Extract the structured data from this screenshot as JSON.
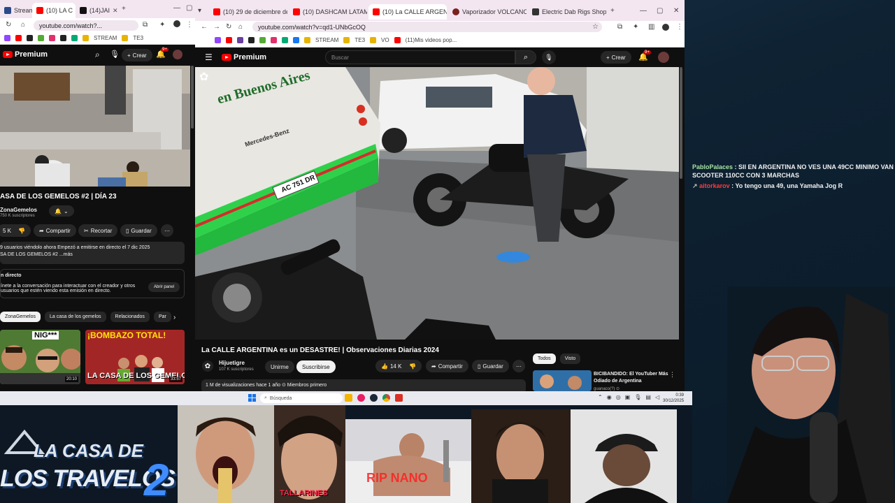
{
  "left_browser": {
    "tabs": [
      {
        "label": "Stream",
        "active": false,
        "color": "#2b4a8a"
      },
      {
        "label": "(10) LA C",
        "active": true,
        "color": "#ff0000"
      },
      {
        "label": "(14)JAI",
        "active": false,
        "color": "#111111"
      }
    ],
    "url": "youtube.com/watch?...",
    "bookmark_label": "STREAM",
    "bookmark_label2": "TE3",
    "yt_brand": "Premium",
    "create_label": "Crear",
    "notif_count": "9+",
    "video_title": "ASA DE LOS GEMELOS #2 | DÍA 23",
    "channel_name": "ZonaGemelos",
    "channel_subs": "750 K suscriptores",
    "likes": "5 K",
    "share_label": "Compartir",
    "clip_label": "Recortar",
    "save_label": "Guardar",
    "desc_line1": "9 usuarios viéndolo ahora  Empezó a emitirse en directo el 7 dic 2025",
    "desc_line2": "SA DE LOS GEMELOS #2 ...más",
    "live_heading": "n directo",
    "live_text1": "ínete a la conversación para interactuar con el creador y otros",
    "live_text2": "usuarios que estén viendo esta emisión en directo.",
    "open_panel": "Abrir panel",
    "chips": [
      "ZonaGemelos",
      "La casa de los gemelos",
      "Relacionados",
      "Par"
    ],
    "thumb1_caption": "NIG***",
    "thumb1_time": "20:10",
    "thumb2_caption": "¡BOMBAZO TOTAL!",
    "thumb2_sub": "LA CASA DE LOS GEMELO",
    "thumb2_time": "33:57"
  },
  "right_browser": {
    "tabs": [
      {
        "label": "(10) 29 de diciembre de 2025",
        "active": false,
        "color": "#ff0000"
      },
      {
        "label": "(10) DASHCAM LATAM #1",
        "active": false,
        "color": "#ff0000"
      },
      {
        "label": "(10) La CALLE ARGENTIN",
        "active": true,
        "color": "#ff0000"
      },
      {
        "label": "Vaporizador VOLCANO HYBR",
        "active": false,
        "color": "#7a2020"
      },
      {
        "label": "Electric Dab Rigs Shop | Puff",
        "active": false,
        "color": "#333333"
      }
    ],
    "url": "youtube.com/watch?v=qd1-UNbGcOQ",
    "bookmarks": [
      "STREAM",
      "TE3",
      "VO",
      "(11)Mis videos pop..."
    ],
    "yt_brand": "Premium",
    "search_placeholder": "Buscar",
    "create_label": "Crear",
    "notif_count": "9+",
    "video_title": "La CALLE ARGENTINA es un DESASTRE! | Observaciones Diarias 2024",
    "channel_name": "Hijuetigre",
    "channel_subs": "107 K suscriptores",
    "join_label": "Unirme",
    "subscribe_label": "Suscribirse",
    "likes": "14 K",
    "share_label": "Compartir",
    "save_label": "Guardar",
    "views_line": "1 M de visualizaciones  hace 1 año  ⊙ Miembros primero",
    "filter_chips": [
      "Todos",
      "Visto"
    ],
    "bus_text": "en Buenos Aires",
    "bus_brand": "Mercedes-Benz",
    "plate": "AC 751 DR",
    "rec_title": "BICIBANDIDO: El YouTuber Más Odiado de Argentina",
    "rec_channel": "guanaco(?) ⊙"
  },
  "taskbar": {
    "search_placeholder": "Búsqueda",
    "time": "0:39",
    "date": "30/12/2025"
  },
  "chat": [
    {
      "user": "PabloPalaces",
      "user_color": "#a6e3a1",
      "message": "SII EN ARGENTINA NO VES UNA 49CC MINIMO VAN SCOOTER 110CC CON 3 MARCHAS"
    },
    {
      "user": "aitorkarov",
      "user_color": "#ff3b3b",
      "message": "Yo tengo una 49, una Yamaha Jog R"
    }
  ],
  "overlay": {
    "logo_line1": "LA CASA DE",
    "logo_line2": "LOS TRAVELOS",
    "logo_number": "2",
    "caption_tallarines": "TALLARINES",
    "caption_rip": "RIP NANO"
  }
}
